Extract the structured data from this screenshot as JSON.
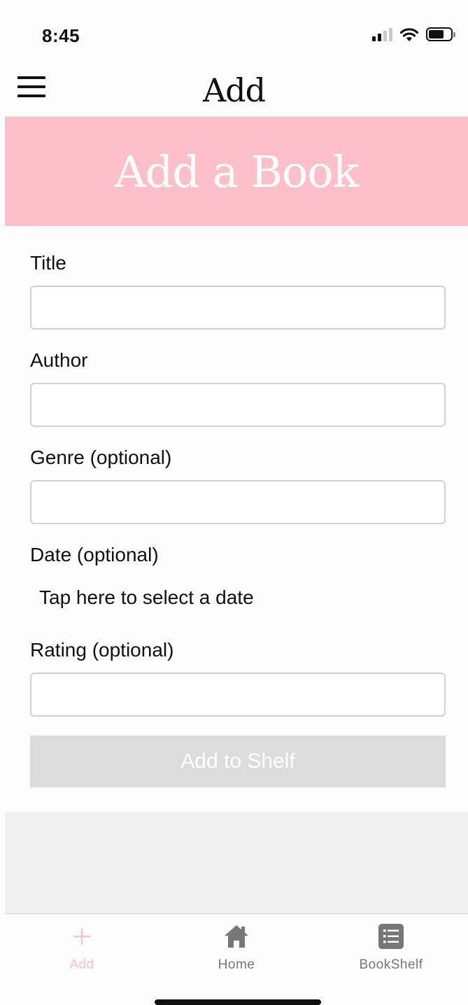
{
  "status_bar": {
    "time": "8:45"
  },
  "header": {
    "title": "Add"
  },
  "banner": {
    "title": "Add a Book"
  },
  "form": {
    "title_label": "Title",
    "title_value": "",
    "author_label": "Author",
    "author_value": "",
    "genre_label": "Genre (optional)",
    "genre_value": "",
    "date_label": "Date (optional)",
    "date_placeholder": "Tap here to select a date",
    "rating_label": "Rating (optional)",
    "rating_value": "",
    "submit_label": "Add to Shelf"
  },
  "tabs": [
    {
      "label": "Add",
      "icon": "plus-icon",
      "active": true
    },
    {
      "label": "Home",
      "icon": "home-icon",
      "active": false
    },
    {
      "label": "BookShelf",
      "icon": "list-icon",
      "active": false
    }
  ],
  "colors": {
    "accent_pink": "#fec0c8",
    "disabled_button": "#dcdcdc",
    "inactive_tab": "#777777"
  }
}
